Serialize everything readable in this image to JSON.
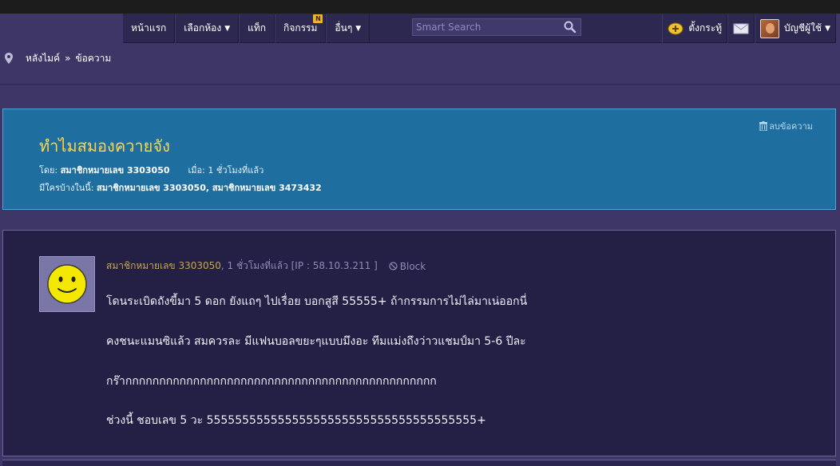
{
  "nav": {
    "home": "หน้าแรก",
    "rooms": "เลือกห้อง",
    "tags": "แท็ก",
    "activities": "กิจกรรม",
    "activities_badge": "N",
    "more": "อื่นๆ",
    "caret": "▼"
  },
  "search": {
    "placeholder": "Smart Search"
  },
  "user_menu": {
    "new_topic": "ตั้งกระทู้",
    "account": "บัญชีผู้ใช้"
  },
  "breadcrumb": {
    "root": "หลังไมค์",
    "separator": "»",
    "current": "ข้อความ"
  },
  "topic": {
    "title": "ทำไมสมองควายจัง",
    "by_label": "โดย:",
    "author": "สมาชิกหมายเลข 3303050",
    "when_label": "เมื่อ:",
    "when": "1 ชั่วโมงที่แล้ว",
    "viewers_label": "มีใครบ้างในนี้:",
    "viewers": "สมาชิกหมายเลข 3303050, สมาชิกหมายเลข 3473432",
    "delete_label": "ลบข้อความ"
  },
  "post": {
    "author": "สมาชิกหมายเลข 3303050",
    "meta": ", 1 ชั่วโมงที่แล้ว [IP : 58.10.3.211 ]",
    "block_label": "Block",
    "lines": [
      "โดนระเบิดถังขี้มา 5 ดอก ยังแถๆ ไปเรื่อย บอกสูสี 55555+ ถ้ากรรมการไม่ไล่มาเน่ออกนี่",
      "คงชนะแมนซิแล้ว สมควรละ มีแฟนบอลขยะๆแบบมึงอะ ทีมแม่งถึงว่าวแชมป์มา 5-6 ปีละ",
      "กร๊ากกกกกกกกกกกกกกกกกกกกกกกกกกกกกกกกกกกกกกกกกกกกกก",
      "ช่วงนี้ ชอบเลข 5 วะ 55555555555555555555555555555555555555+"
    ]
  },
  "colors": {
    "page_bg": "#3d3666",
    "nav_bg": "#2d2850",
    "topic_bg": "#1e6fa0",
    "topic_title": "#ffd447",
    "post_bg": "#231f45",
    "post_author": "#c9a84a"
  },
  "icons": [
    "location-pin-icon",
    "search-icon",
    "post-it-icon",
    "mail-icon",
    "trash-icon",
    "block-icon",
    "smiley-avatar-icon"
  ]
}
